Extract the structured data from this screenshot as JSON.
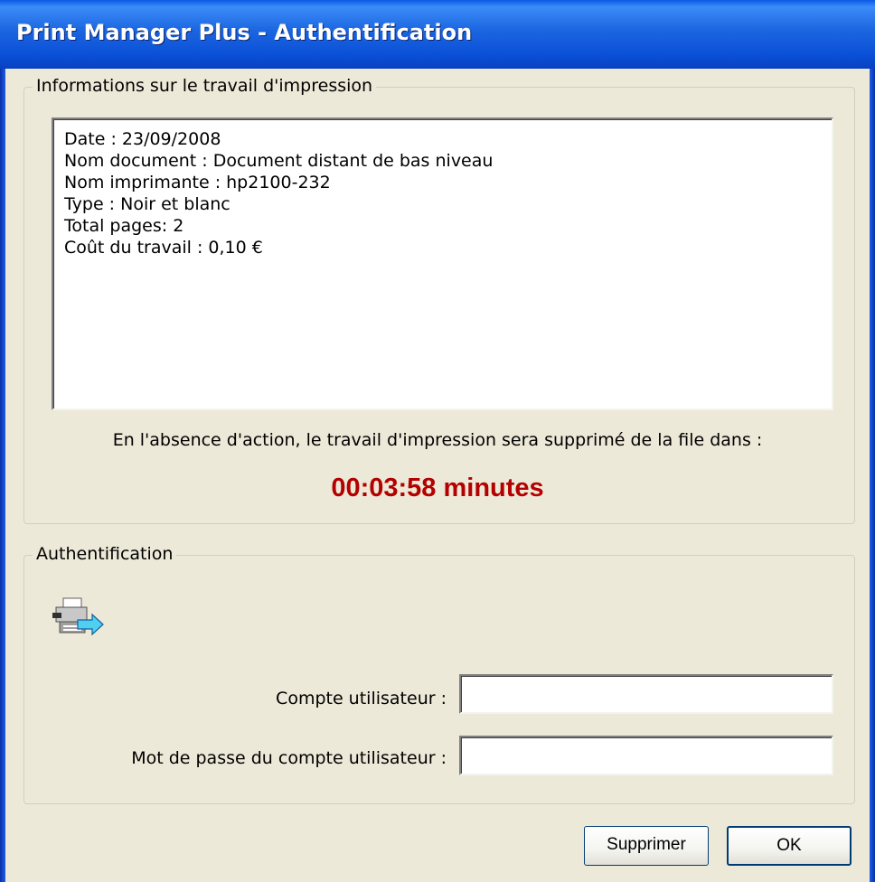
{
  "window": {
    "title": "Print Manager Plus - Authentification"
  },
  "job_group": {
    "label": "Informations sur le travail d'impression",
    "lines": [
      "Date : 23/09/2008",
      "Nom document : Document distant de bas niveau",
      "Nom imprimante : hp2100-232",
      "Type : Noir et blanc",
      "Total pages: 2",
      "Coût du travail : 0,10 €"
    ],
    "notice": "En l'absence d'action, le travail d'impression sera supprimé de la file dans :",
    "countdown": "00:03:58 minutes",
    "countdown_color": "#b40000"
  },
  "auth_group": {
    "label": "Authentification",
    "icon": "printer-transfer-icon",
    "user_label": "Compte utilisateur :",
    "user_value": "",
    "password_label": "Mot de passe du compte utilisateur :",
    "password_value": ""
  },
  "buttons": {
    "delete": "Supprimer",
    "ok": "OK"
  },
  "colors": {
    "titlebar": "#0b50d8",
    "dialog_bg": "#ece9d8"
  }
}
